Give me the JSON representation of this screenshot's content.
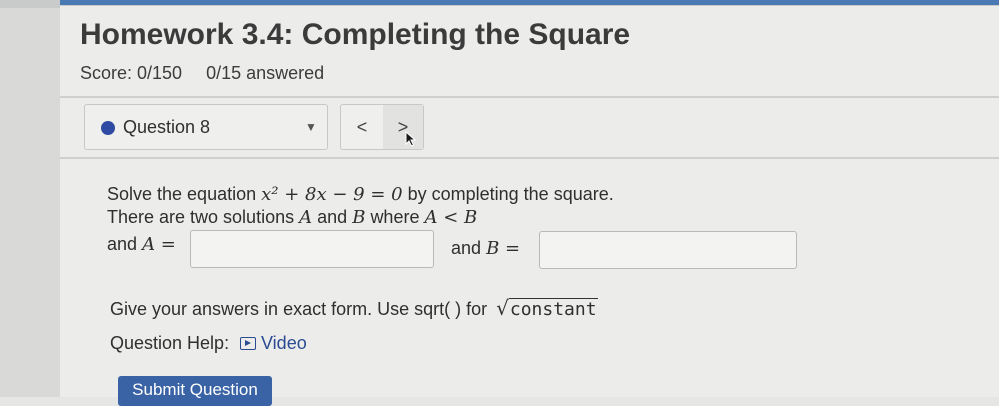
{
  "header": {
    "title": "Homework 3.4: Completing the Square",
    "score": "Score: 0/150",
    "answered": "0/15 answered"
  },
  "question_nav": {
    "selected": "Question 8",
    "prev_label": "<",
    "next_label": ">"
  },
  "question": {
    "line1_prefix": "Solve the equation",
    "line1_eq": "x² + 8x − 9 = 0",
    "line1_suffix": "by completing the square.",
    "line2_prefix": "There are two solutions",
    "var_a": "A",
    "line2_and": "and",
    "var_b": "B",
    "line2_where": "where",
    "line2_ineq": "A < B",
    "label_a_prefix": "and",
    "label_a_eq": "A =",
    "label_b_prefix": "and",
    "label_b_eq": "B =",
    "input_a_value": "",
    "input_b_value": ""
  },
  "hint": {
    "text": "Give your answers in exact form. Use sqrt( ) for",
    "sqrt_symbol": "√",
    "radicand": "constant"
  },
  "help": {
    "label": "Question Help:",
    "video_label": "Video"
  },
  "submit_label": "Submit Question",
  "colors": {
    "accent": "#2f4aa3",
    "link": "#2a4a92",
    "submit_bg": "#3a63a6"
  }
}
